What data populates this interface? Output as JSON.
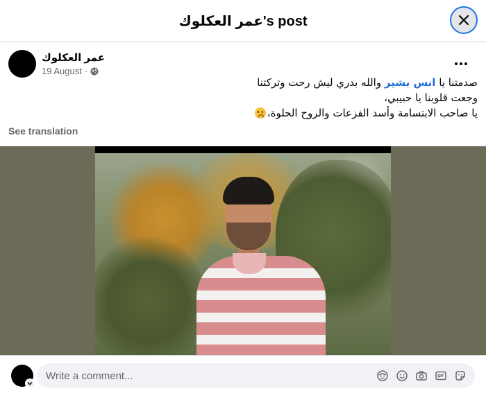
{
  "header": {
    "title": "عمر العكلوك's post",
    "close_icon": "close-icon"
  },
  "post": {
    "author": "عمر العكلوك",
    "date": "19 August",
    "separator": "·",
    "privacy_icon": "globe-icon",
    "more_icon": "more-horizontal-icon",
    "text": {
      "line1_prefix": "صدمتنا يا ",
      "mention": "انس بشير",
      "line1_suffix": "  والله بدري ليش رحت وتركتنا",
      "line2": "وجعت قلوبنا يا حبيبي،",
      "line3": "يا صاحب الابتسامة وأسد الفزعات والروح الحلوة،",
      "emoji": "crying-face-emoji"
    },
    "see_translation": "See translation"
  },
  "comment": {
    "placeholder": "Write a comment...",
    "icons": [
      "avatar-sticker-icon",
      "emoji-icon",
      "camera-icon",
      "gif-icon",
      "sticker-icon"
    ]
  },
  "colors": {
    "mention": "#216fdb",
    "close_ring": "#1b74e4",
    "muted_text": "#65676b",
    "input_bg": "#f0f2f5"
  }
}
